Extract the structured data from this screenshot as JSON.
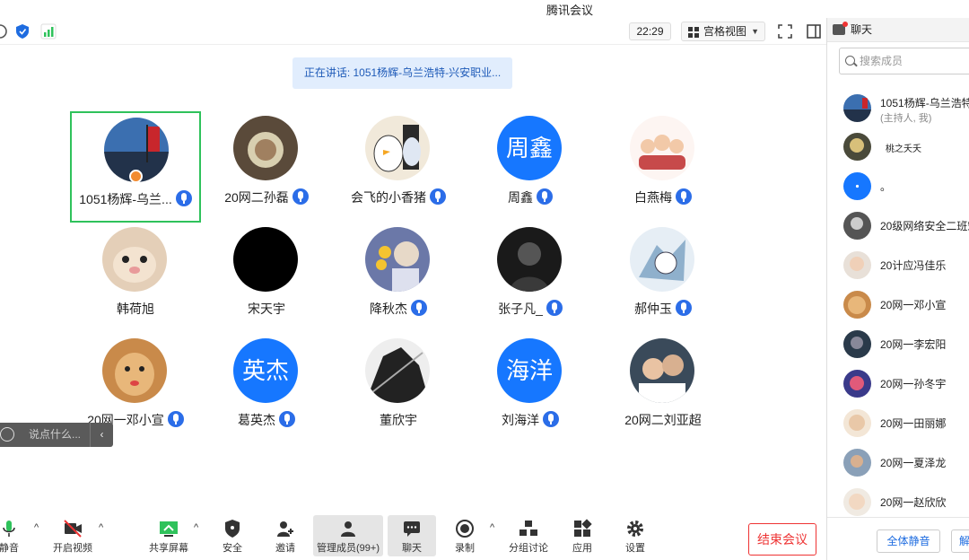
{
  "window": {
    "title": "腾讯会议"
  },
  "topbar": {
    "time": "22:29",
    "view_mode": "宫格视图"
  },
  "speaking": {
    "text": "正在讲话: 1051杨辉-乌兰浩特-兴安职业..."
  },
  "participants": [
    {
      "name": "1051杨辉-乌兰...",
      "mic": true,
      "host": true
    },
    {
      "name": "20网二孙磊",
      "mic": true
    },
    {
      "name": "会飞的小香猪",
      "mic": true
    },
    {
      "name": "周鑫",
      "mic": true,
      "avatar_text": "周鑫"
    },
    {
      "name": "白燕梅",
      "mic": true
    },
    {
      "name": "韩荷旭",
      "mic": false
    },
    {
      "name": "宋天宇",
      "mic": false
    },
    {
      "name": "降秋杰",
      "mic": true
    },
    {
      "name": "张子凡_",
      "mic": true
    },
    {
      "name": "郝仲玉",
      "mic": true
    },
    {
      "name": "20网一邓小宣",
      "mic": true
    },
    {
      "name": "葛英杰",
      "mic": true,
      "avatar_text": "英杰"
    },
    {
      "name": "董欣宇",
      "mic": false
    },
    {
      "name": "刘海洋",
      "mic": true,
      "avatar_text": "海洋"
    },
    {
      "name": "20网二刘亚超",
      "mic": false
    }
  ],
  "chat_input": {
    "placeholder": "说点什么..."
  },
  "toolbar": {
    "mute": "静音",
    "video": "开启视频",
    "share": "共享屏幕",
    "security": "安全",
    "invite": "邀请",
    "members": "管理成员(99+)",
    "chat": "聊天",
    "record": "录制",
    "breakout": "分组讨论",
    "apps": "应用",
    "settings": "设置",
    "end": "结束会议"
  },
  "side": {
    "tab": "聊天",
    "search_placeholder": "搜索成员",
    "members": [
      {
        "name": "1051杨辉-乌兰浩特",
        "sub": "(主持人, 我)"
      },
      {
        "name": "桃之夭夭"
      },
      {
        "name": "。"
      },
      {
        "name": "20级网络安全二班宋"
      },
      {
        "name": "20计应冯佳乐"
      },
      {
        "name": "20网一邓小宣"
      },
      {
        "name": "20网一李宏阳"
      },
      {
        "name": "20网一孙冬宇"
      },
      {
        "name": "20网一田丽娜"
      },
      {
        "name": "20网一夏泽龙"
      },
      {
        "name": "20网一赵欣欣"
      }
    ],
    "mute_all": "全体静音",
    "more": "解"
  }
}
